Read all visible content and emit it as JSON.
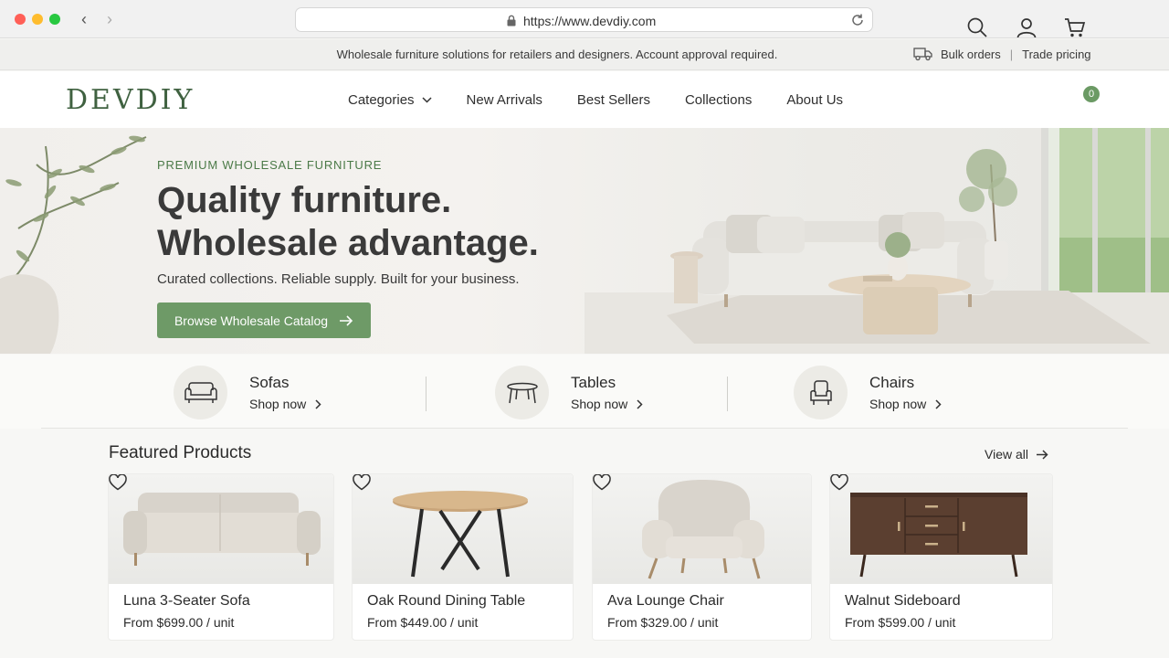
{
  "browser": {
    "url": "https://www.devdiy.com"
  },
  "announcement": {
    "message": "Wholesale furniture solutions for retailers and designers. Account approval required.",
    "bulk_orders": "Bulk orders",
    "trade_pricing": "Trade pricing"
  },
  "header": {
    "logo": "DEVDIY",
    "nav": [
      "Categories",
      "New Arrivals",
      "Best Sellers",
      "Collections",
      "About Us"
    ],
    "cart_count": "0"
  },
  "hero": {
    "eyebrow": "PREMIUM WHOLESALE FURNITURE",
    "headline_line1": "Quality furniture.",
    "headline_line2": "Wholesale advantage.",
    "subtext": "Curated collections. Reliable supply. Built for your business.",
    "cta": "Browse Wholesale Catalog"
  },
  "categories": [
    {
      "name": "Sofas",
      "link": "Shop now",
      "icon": "sofa-icon"
    },
    {
      "name": "Tables",
      "link": "Shop now",
      "icon": "table-icon"
    },
    {
      "name": "Chairs",
      "link": "Shop now",
      "icon": "chair-icon"
    }
  ],
  "featured": {
    "title": "Featured Products",
    "view_all": "View all",
    "products": [
      {
        "name": "Luna 3-Seater Sofa",
        "price": "From $699.00 / unit"
      },
      {
        "name": "Oak Round Dining Table",
        "price": "From $449.00 / unit"
      },
      {
        "name": "Ava Lounge Chair",
        "price": "From $329.00 / unit"
      },
      {
        "name": "Walnut Sideboard",
        "price": "From $599.00 / unit"
      }
    ]
  },
  "colors": {
    "brand_green": "#3f6140",
    "cta_green": "#6e9a67",
    "badge_green": "#6b9a64"
  }
}
